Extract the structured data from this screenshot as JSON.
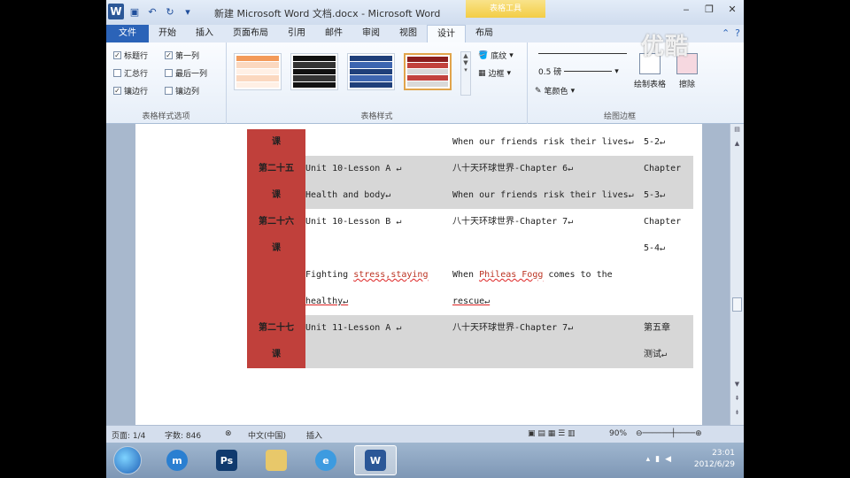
{
  "window": {
    "title": "新建 Microsoft Word 文档.docx - Microsoft Word",
    "context_tab": "表格工具",
    "min": "‒",
    "restore": "❐",
    "close": "✕"
  },
  "tabs": [
    {
      "label": "文件"
    },
    {
      "label": "开始"
    },
    {
      "label": "插入"
    },
    {
      "label": "页面布局"
    },
    {
      "label": "引用"
    },
    {
      "label": "邮件"
    },
    {
      "label": "审阅"
    },
    {
      "label": "视图"
    },
    {
      "label": "设计"
    },
    {
      "label": "布局"
    }
  ],
  "ribbon": {
    "table_style_options": {
      "label": "表格样式选项",
      "header_row": {
        "label": "标题行",
        "checked": true
      },
      "first_column": {
        "label": "第一列",
        "checked": true
      },
      "total_row": {
        "label": "汇总行",
        "checked": false
      },
      "last_column": {
        "label": "最后一列",
        "checked": false
      },
      "banded_rows": {
        "label": "镶边行",
        "checked": true
      },
      "banded_columns": {
        "label": "镶边列",
        "checked": false
      }
    },
    "table_styles": {
      "label": "表格样式",
      "shading": "底纹",
      "borders": "边框"
    },
    "draw_borders": {
      "label": "绘图边框",
      "pen_weight": "0.5 磅",
      "pen_color": "笔颜色",
      "draw_table": "绘制表格",
      "eraser": "擦除"
    }
  },
  "table": {
    "rows": [
      {
        "lesson": [
          "课"
        ],
        "unit": [],
        "book": [
          "When our friends risk their lives↵"
        ],
        "extra": [
          "5-2↵"
        ],
        "grey": false
      },
      {
        "lesson": [
          "第二十五",
          "课"
        ],
        "unit": [
          "Unit 10-Lesson A ↵",
          "Health and body↵"
        ],
        "book": [
          "八十天环球世界-Chapter 6↵",
          "When our friends risk their lives↵"
        ],
        "extra": [
          "Chapter",
          "5-3↵"
        ],
        "grey": true
      },
      {
        "lesson": [
          "第二十六",
          "课"
        ],
        "unit": [
          "Unit 10-Lesson B ↵",
          "",
          "Fighting stress,staying",
          "healthy↵"
        ],
        "book": [
          "八十天环球世界-Chapter 7↵",
          "",
          "When Phileas Fogg comes to the",
          "rescue↵"
        ],
        "extra": [
          "Chapter",
          "5-4↵"
        ],
        "grey": false
      },
      {
        "lesson": [
          "第二十七",
          "课"
        ],
        "unit": [
          "Unit 11-Lesson A ↵"
        ],
        "book": [
          "八十天环球世界-Chapter 7↵"
        ],
        "extra": [
          "第五章",
          "测试↵"
        ],
        "grey": true
      }
    ]
  },
  "status": {
    "page": "页面: 1/4",
    "words": "字数: 846",
    "language": "中文(中国)",
    "mode": "插入",
    "zoom": "90%"
  },
  "taskbar": {
    "time": "23:01",
    "date": "2012/6/29"
  },
  "watermark": "优酷",
  "colors": {
    "lesson_red": "#c0403b",
    "band_grey": "#d7d7d7",
    "file_tab": "#2b63b8"
  }
}
